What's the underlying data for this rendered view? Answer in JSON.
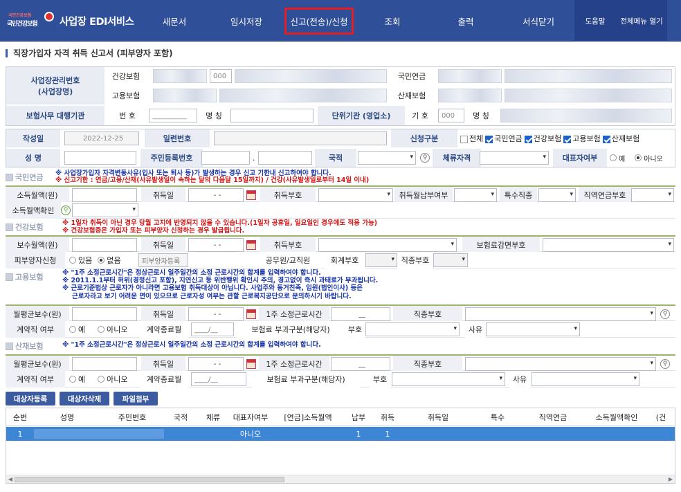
{
  "header": {
    "logo_top": "국민건강보험",
    "logo_text": "국민건강보험",
    "title": "사업장 EDI서비스",
    "nav": [
      "새문서",
      "임시저장",
      "신고(전송)/신청",
      "조회",
      "출력",
      "서식닫기"
    ],
    "nav_extra": [
      "도움말",
      "전체메뉴 열기"
    ]
  },
  "page_title": "직장가입자 자격 취득 신고서 (피부양자 포함)",
  "company": {
    "label1": "사업장관리번호",
    "label2": "(사업장명)",
    "health": "건강보험",
    "employ": "고용보험",
    "pension": "국민연금",
    "industrial": "산재보험",
    "health_code": "000",
    "agency_label": "보험사무 대행기관",
    "num_label": "번 호",
    "num_value": "__________",
    "name_label": "명 칭",
    "unit_label": "단위기관 (영업소)",
    "code_label": "기 호",
    "code_value": "000",
    "unit_name_label": "명 칭"
  },
  "form": {
    "date_label": "작성일",
    "date_value": "2022-12-25",
    "serial_label": "일련번호",
    "apply_label": "신청구분",
    "apply_all": "전체",
    "apply_opts": [
      "국민연금",
      "건강보험",
      "고용보험",
      "산재보험"
    ],
    "name_label": "성 명",
    "rrn_label": "주민등록번호",
    "nation_label": "국적",
    "stay_label": "체류자격",
    "rep_label": "대표자여부",
    "rep_yes": "예",
    "rep_no": "아니오"
  },
  "pension": {
    "title": "국민연금",
    "warn1": "※ 사업장가입자 자격변동사유(입사 또는 퇴사 등)가 발생하는 경우 신고 기한내 신고하여야 합니다.",
    "warn2": "※ 신고기한 : 연금/고용/산재(사유발생일이 속하는 달의 다음달 15일까지) / 건강(사유발생일로부터 14일 이내)",
    "income": "소득월액(원)",
    "acq_date": "취득일",
    "date_ph": "-   -",
    "acq_code": "취득부호",
    "acq_month": "취득월납부여부",
    "special": "특수직종",
    "job_pension": "직역연금부호",
    "income_check": "소득월액확인"
  },
  "health": {
    "title": "건강보험",
    "warn1": "※ 1일자 취득이 아닌 경우 당월 고지에 반영되지 않을 수 있습니다.(1일자 공휴일, 일요일인 경우에도 적용 가능)",
    "warn2": "※ 건강보험증은 가입자 또는 피부양자 신청하는 경우 발급됩니다.",
    "pay": "보수월액(원)",
    "acq_date": "취득일",
    "acq_code": "취득부호",
    "reduce": "보험료감면부호",
    "dep": "피부양자신청",
    "dep_yes": "있음",
    "dep_no": "없음",
    "dep_btn": "피부양자등록",
    "public": "공무원/교직원",
    "acct": "회계부호",
    "jobcode": "직종부호"
  },
  "employment": {
    "title": "고용보험",
    "warn1": "※ \"1주 소정근로시간\"은 정상근로시 일주일간의 소정 근로시간의 합계를 입력하여야 합니다.",
    "warn2": "※ 2011.1.1부터 허위(경정신고 포함), 지연신고 등 위반행위 확인시 주의, 경고없이 즉시 과태료가 부과됩니다.",
    "warn3": "※ 근로기준법상 근로자가 아니라면 고용보험 취득대상이 아닙니다. 사업주와 동거친족, 임원(법인이사) 등은",
    "warn4": "근로자라고 보기 어려운 면이 있으므로 근로자성 여부는 관할 근로복지공단으로 문의하시기 바랍니다.",
    "avg_pay": "월평균보수(원)",
    "acq_date": "취득일",
    "hours": "1주 소정근로시간",
    "hours_val": "__",
    "jobcode": "직종부호",
    "contract": "계약직 여부",
    "yes": "예",
    "no": "아니오",
    "end_month": "계약종료월",
    "end_val": "____/__",
    "premium": "보험료 부과구분(해당자)",
    "code": "부호",
    "reason": "사유"
  },
  "industrial": {
    "title": "산재보험",
    "warn1": "※ \"1주 소정근로시간\"은 정상근로시 일주일간의 소정 근로시간의 합계를 입력하여야 합니다.",
    "avg_pay": "월평균보수(원)",
    "acq_date": "취득일",
    "hours": "1주 소정근로시간",
    "hours_val": "__",
    "jobcode": "직종부호",
    "contract": "계약직 여부",
    "yes": "예",
    "no": "아니오",
    "end_month": "계약종료월",
    "end_val": "____/__",
    "premium": "보험료 부과구분(해당자)",
    "code": "부호",
    "reason": "사유"
  },
  "buttons": [
    "대상자등록",
    "대상자삭제",
    "파일첨부"
  ],
  "grid": {
    "columns": [
      "순번",
      "성명",
      "주민번호",
      "국적",
      "체류",
      "대표자여부",
      "[연금]소득월액",
      "납부",
      "취득",
      "취득일",
      "특수",
      "직역연금",
      "소득월액확인",
      "(건"
    ],
    "row": [
      "1",
      "",
      "",
      "",
      "",
      "아니오",
      "",
      "1",
      "1",
      "",
      "",
      "",
      "",
      ""
    ]
  }
}
